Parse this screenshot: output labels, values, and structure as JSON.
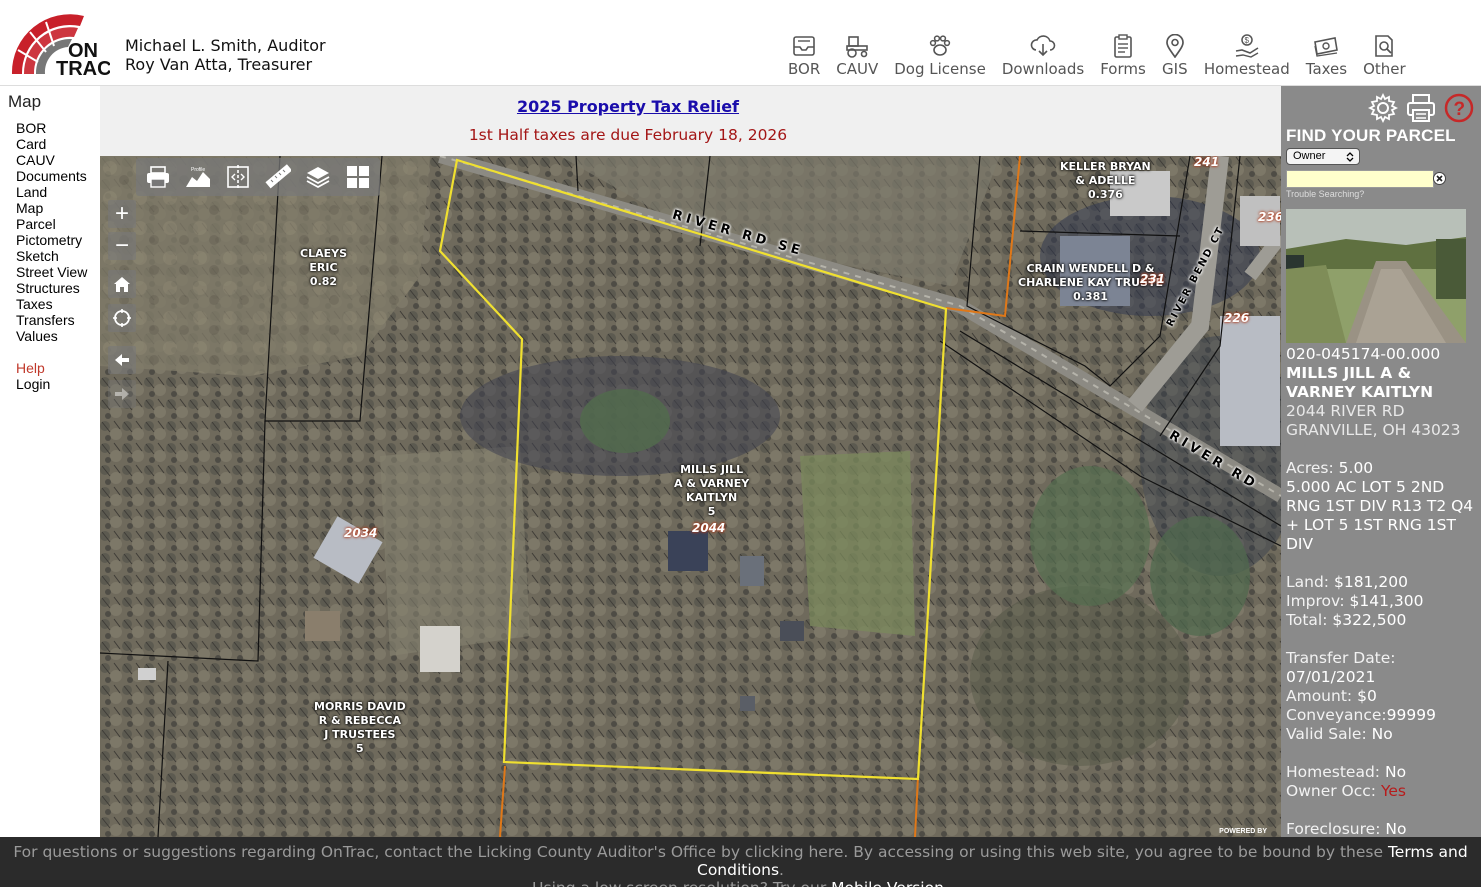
{
  "header": {
    "logo_text": "ONTRAC",
    "logo_line1": "ON",
    "logo_line2": "TRAC",
    "auditor": "Michael L. Smith, Auditor",
    "treasurer": "Roy Van Atta, Treasurer",
    "nav": [
      {
        "label": "BOR",
        "icon": "inbox-tray-icon"
      },
      {
        "label": "CAUV",
        "icon": "tractor-icon"
      },
      {
        "label": "Dog License",
        "icon": "paw-icon"
      },
      {
        "label": "Downloads",
        "icon": "cloud-download-icon"
      },
      {
        "label": "Forms",
        "icon": "clipboard-icon"
      },
      {
        "label": "GIS",
        "icon": "map-pin-icon"
      },
      {
        "label": "Homestead",
        "icon": "hand-coin-icon"
      },
      {
        "label": "Taxes",
        "icon": "money-bill-icon"
      },
      {
        "label": "Other",
        "icon": "document-search-icon"
      }
    ]
  },
  "sidebar": {
    "title": "Map",
    "items": [
      "BOR",
      "Card",
      "CAUV",
      "Documents",
      "Land",
      "Map",
      "Parcel",
      "Pictometry",
      "Sketch",
      "Street View",
      "Structures",
      "Taxes",
      "Transfers",
      "Values"
    ],
    "help": "Help",
    "login": "Login"
  },
  "banner": {
    "link": "2025 Property Tax Relief",
    "due": "1st Half taxes are due February 18, 2026"
  },
  "map": {
    "toolbar": [
      "print-icon",
      "profile-icon",
      "split-view-icon",
      "measure-ruler-icon",
      "layers-icon",
      "grid-icon"
    ],
    "profile_label": "Profile",
    "zoom_in": "+",
    "zoom_out": "−",
    "labels": {
      "claeys": [
        "CLAEYS",
        "ERIC",
        "0.82"
      ],
      "keller": [
        "KELLER BRYAN",
        "& ADELLE",
        "0.376"
      ],
      "crain": [
        "CRAIN WENDELL D &",
        "CHARLENE KAY TRUSTE",
        "0.381"
      ],
      "mills": [
        "MILLS JILL",
        "A & VARNEY",
        "KAITLYN",
        "5"
      ],
      "morris": [
        "MORRIS DAVID",
        "R & REBECCA",
        "J TRUSTEES",
        "5"
      ]
    },
    "addresses": {
      "a2044": "2044",
      "a2034": "2034",
      "a231": "231",
      "a226": "226",
      "a236": "236",
      "a241": "241"
    },
    "roads": {
      "river_rd_se": "RIVER RD SE",
      "river_bend_ct": "RIVER BEND CT",
      "river_rd": "RIVER RD"
    },
    "powered_by": "POWERED BY"
  },
  "panel": {
    "icons": [
      "gear-icon",
      "print-icon",
      "help-icon"
    ],
    "find_title": "FIND YOUR PARCEL",
    "search_mode": "Owner",
    "search_value": "",
    "trouble": "Trouble Searching?",
    "parcel_id": "020-045174-00.000",
    "owner": "MILLS JILL A & VARNEY KAITLYN",
    "address1": "2044 RIVER RD",
    "address2": "GRANVILLE, OH 43023",
    "acres_label": "Acres:",
    "acres": "5.00",
    "legal": "5.000 AC LOT 5 2ND RNG 1ST DIV R13 T2 Q4 + LOT 5 1ST RNG 1ST DIV",
    "land_label": "Land:",
    "land": "$181,200",
    "improv_label": "Improv:",
    "improv": "$141,300",
    "total_label": "Total:",
    "total": "$322,500",
    "transfer_label": "Transfer Date:",
    "transfer_date": "07/01/2021",
    "amount_label": "Amount:",
    "amount": "$0",
    "conveyance_label": "Conveyance:",
    "conveyance": "99999",
    "valid_label": "Valid Sale:",
    "valid_sale": "No",
    "homestead_label": "Homestead:",
    "homestead": "No",
    "owner_occ_label": "Owner Occ:",
    "owner_occ": "Yes",
    "foreclosure_label": "Foreclosure:",
    "foreclosure": "No"
  },
  "footer": {
    "text1": "For questions or suggestions regarding OnTrac, contact the Licking County Auditor's Office by clicking here. By accessing or using this web site, you agree to be bound by these",
    "terms": "Terms and Conditions",
    "period": ".",
    "text2": "Using a low screen resolution? Try our",
    "mobile": "Mobile Version",
    "period2": "."
  },
  "colors": {
    "banner_link": "#1a0dab",
    "due_red": "#a31515",
    "panel_bg": "#8a8a8a",
    "parcel_yellow": "#f0e030",
    "parcel_orange": "#e07818",
    "logo_red": "#c8202a"
  }
}
